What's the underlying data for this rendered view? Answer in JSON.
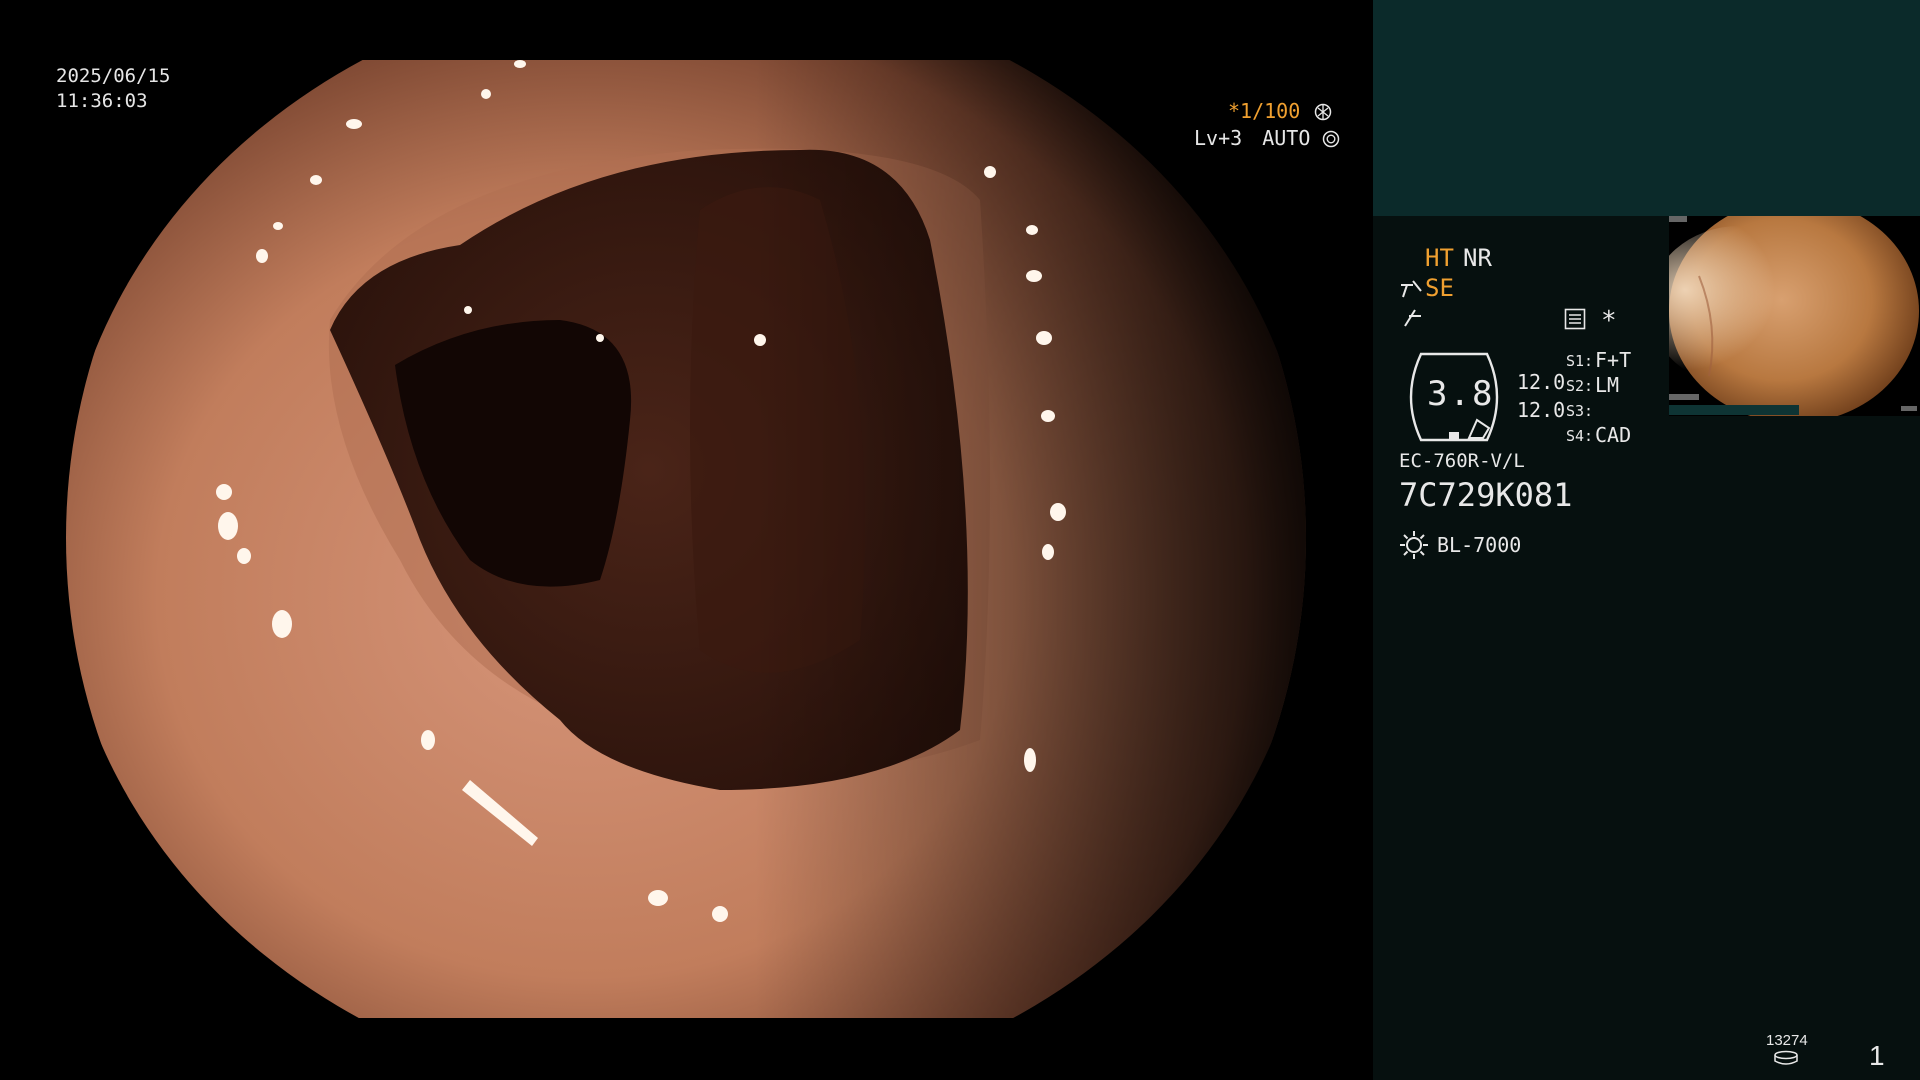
{
  "video": {
    "date": "2025/06/15",
    "time": "11:36:03",
    "shutter": "*1/100",
    "shutter_icon": "aperture-icon",
    "level": "Lv+3",
    "mode": "AUTO",
    "mode_icon": "iris-icon"
  },
  "side": {
    "ht": "HT",
    "nr": "NR",
    "se": "SE",
    "se_icon": "enhancement-icon",
    "zoom_icon": "zoom-icon",
    "menu_icon": "settings-list-icon",
    "star": "*",
    "gauge_value": "3.8",
    "val1": "12.0",
    "val2": "12.0",
    "s1_label": "S1:",
    "s1_value": "F+T",
    "s2_label": "S2:",
    "s2_value": "LM",
    "s3_label": "S3:",
    "s3_value": "",
    "s4_label": "S4:",
    "s4_value": "CAD",
    "scope_model": "EC-760R-V/L",
    "scope_serial": "7C729K081",
    "light_icon": "light-source-icon",
    "light_source": "BL-7000",
    "storage_count": "13274",
    "storage_icon": "storage-disk-icon",
    "image_number": "1"
  },
  "colors": {
    "accent_orange": "#f0a030",
    "panel_bg": "#06100f",
    "panel_top": "#0b2a2a",
    "text": "#e8e8e8"
  }
}
